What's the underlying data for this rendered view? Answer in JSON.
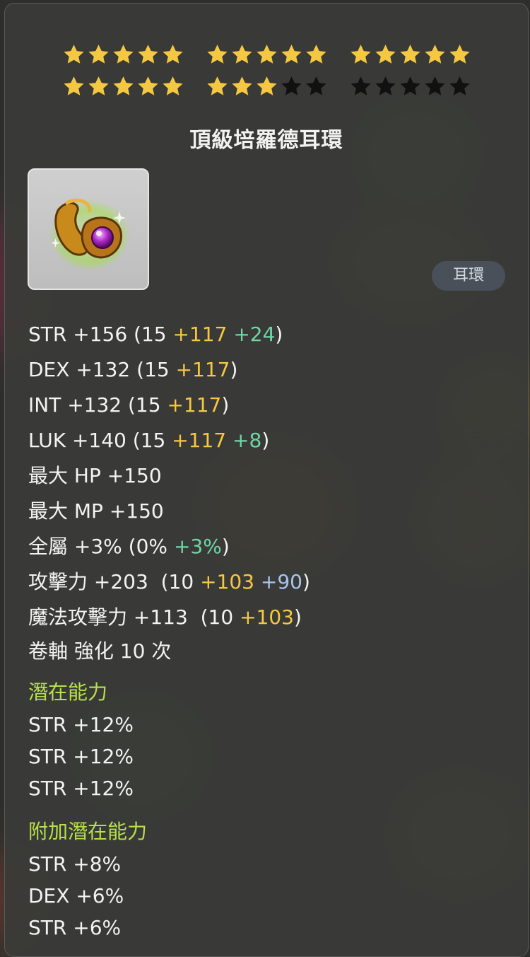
{
  "stars": {
    "total": 30,
    "filled": 23,
    "filled_color": "#f5c842",
    "empty_color": "#111111"
  },
  "item": {
    "name": "頂級培羅德耳環",
    "type_badge": "耳環",
    "icon": "earring-icon"
  },
  "stats": [
    {
      "parts": [
        {
          "t": "STR +156 (15 ",
          "c": "white"
        },
        {
          "t": "+117",
          "c": "yellow"
        },
        {
          "t": " ",
          "c": "white"
        },
        {
          "t": "+24",
          "c": "green"
        },
        {
          "t": ")",
          "c": "white"
        }
      ]
    },
    {
      "parts": [
        {
          "t": "DEX +132 (15 ",
          "c": "white"
        },
        {
          "t": "+117",
          "c": "yellow"
        },
        {
          "t": ")",
          "c": "white"
        }
      ]
    },
    {
      "parts": [
        {
          "t": "INT +132 (15 ",
          "c": "white"
        },
        {
          "t": "+117",
          "c": "yellow"
        },
        {
          "t": ")",
          "c": "white"
        }
      ]
    },
    {
      "parts": [
        {
          "t": "LUK +140 (15 ",
          "c": "white"
        },
        {
          "t": "+117",
          "c": "yellow"
        },
        {
          "t": " ",
          "c": "white"
        },
        {
          "t": "+8",
          "c": "green"
        },
        {
          "t": ")",
          "c": "white"
        }
      ]
    },
    {
      "parts": [
        {
          "t": "最大 HP +150",
          "c": "white"
        }
      ]
    },
    {
      "parts": [
        {
          "t": "最大 MP +150",
          "c": "white"
        }
      ]
    },
    {
      "parts": [
        {
          "t": "全屬 +3% (0% ",
          "c": "white"
        },
        {
          "t": "+3%",
          "c": "green"
        },
        {
          "t": ")",
          "c": "white"
        }
      ]
    },
    {
      "parts": [
        {
          "t": "攻擊力 +203  (10 ",
          "c": "white"
        },
        {
          "t": "+103",
          "c": "yellow"
        },
        {
          "t": " ",
          "c": "white"
        },
        {
          "t": "+90",
          "c": "blue"
        },
        {
          "t": ")",
          "c": "white"
        }
      ]
    },
    {
      "parts": [
        {
          "t": "魔法攻擊力 +113  (10 ",
          "c": "white"
        },
        {
          "t": "+103",
          "c": "yellow"
        },
        {
          "t": ")",
          "c": "white"
        }
      ]
    }
  ],
  "scroll_line": "卷軸 強化 10 次",
  "potential": {
    "title": "潛在能力",
    "lines": [
      "STR +12%",
      "STR +12%",
      "STR +12%"
    ]
  },
  "bonus_potential": {
    "title": "附加潛在能力",
    "lines": [
      "STR +8%",
      "DEX +6%",
      "STR +6%"
    ]
  }
}
